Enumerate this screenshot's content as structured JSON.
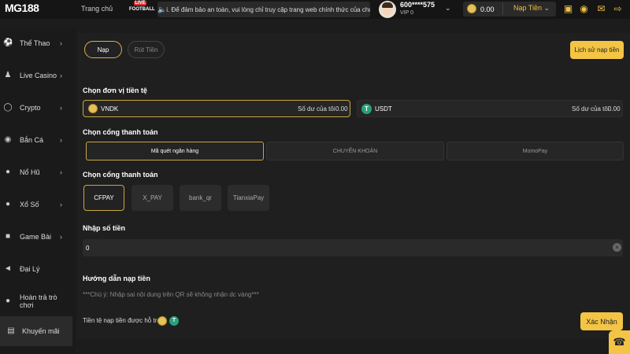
{
  "header": {
    "logo_text": "MG188",
    "nav_home": "Trang chủ",
    "live_badge": "LIVE",
    "football_label": "FOOTBALL",
    "marquee_text": "i. Để đảm bảo an toàn, vui lòng chỉ truy cập trang web chính thức của chúng",
    "user_id": "600****575",
    "vip_level": "VIP 0",
    "balance": "0.00",
    "deposit_dropdown": "Nạp Tiền"
  },
  "sidebar": {
    "items": [
      {
        "label": "Thể Thao",
        "icon": "soccer-ball-icon",
        "has_chevron": true
      },
      {
        "label": "Live Casino",
        "icon": "dealer-icon",
        "has_chevron": true
      },
      {
        "label": "Crypto",
        "icon": "crypto-icon",
        "has_chevron": true
      },
      {
        "label": "Bắn Cá",
        "icon": "fish-icon",
        "has_chevron": true
      },
      {
        "label": "Nổ Hũ",
        "icon": "slot-icon",
        "has_chevron": true
      },
      {
        "label": "Xổ Số",
        "icon": "lottery-icon",
        "has_chevron": true
      },
      {
        "label": "Game Bài",
        "icon": "cards-icon",
        "has_chevron": true
      },
      {
        "label": "Đại Lý",
        "icon": "megaphone-icon",
        "has_chevron": false
      },
      {
        "label": "Hoàn trả trò chơi",
        "icon": "refund-icon",
        "has_chevron": false
      },
      {
        "label": "Khuyến mãi",
        "icon": "gift-icon",
        "has_chevron": false
      }
    ]
  },
  "tabs": {
    "deposit": "Nạp",
    "withdraw": "Rút Tiền"
  },
  "history_button": "Lịch sử nạp tiền",
  "currency": {
    "title": "Chọn đơn vị tiền tệ",
    "options": [
      {
        "name": "VNDK",
        "balance_label": "Số dư của tôi",
        "balance": "0.00",
        "selected": true
      },
      {
        "name": "USDT",
        "balance_label": "Số dư của tôi",
        "balance": "0.00",
        "selected": false
      }
    ]
  },
  "gateway": {
    "title": "Chọn cổng thanh toán",
    "options": [
      "Mã quét ngân hàng",
      "CHUYỂN KHOẢN",
      "MomoPay"
    ]
  },
  "provider": {
    "title": "Chọn cổng thanh toán",
    "options": [
      "CFPAY",
      "X_PAY",
      "bank_qr",
      "TianxiaPay"
    ]
  },
  "amount": {
    "title": "Nhập số tiền",
    "value": "0"
  },
  "guide": {
    "title": "Hướng dẫn nạp tiền",
    "note": "***Chú ý: Nhập sai nội dung trên QR sẽ không nhận dc vàng***"
  },
  "supported_label": "Tiền tệ nạp tiền được hỗ trợ",
  "confirm_button": "Xác Nhận",
  "colors": {
    "accent": "#f4c445",
    "tether": "#26a17b",
    "background": "#1c1c1c"
  }
}
